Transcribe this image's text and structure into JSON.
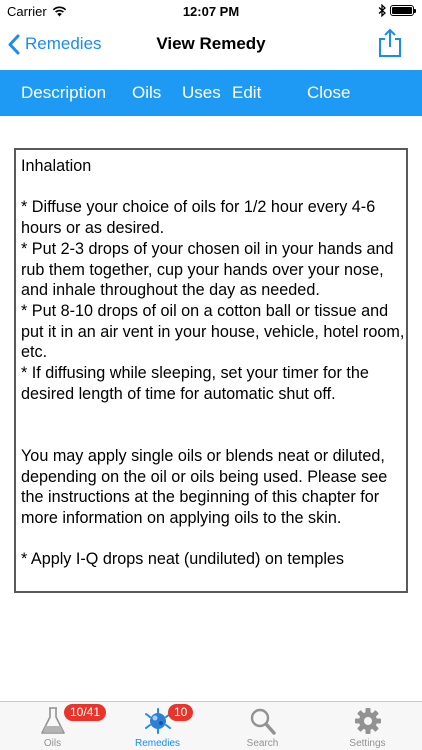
{
  "status_bar": {
    "carrier": "Carrier",
    "time": "12:07 PM",
    "signal_icon": "wifi-icon",
    "battery_icon": "battery-icon",
    "battery_level": 1.0
  },
  "nav": {
    "back_label": "Remedies",
    "title": "View Remedy",
    "share_icon": "share-icon"
  },
  "tabs": {
    "description": "Description",
    "oils": "Oils",
    "uses": "Uses",
    "edit": "Edit",
    "close": "Close"
  },
  "content": {
    "text": "Inhalation\n\n* Diffuse your choice of oils for 1/2 hour every 4-6 hours or as desired.\n* Put 2-3 drops of your chosen oil in your hands and rub them together, cup your hands over your nose, and inhale throughout the day as needed.\n* Put 8-10 drops of oil on a cotton ball or tissue and put it in an air vent in your house, vehicle, hotel room, etc.\n* If diffusing while sleeping, set your timer for the desired length of time for automatic shut off.\n\n\nYou may apply single oils or blends neat or diluted, depending on the oil or oils being used. Please see the instructions at the beginning of this chapter for more information on applying oils to the skin.\n\n* Apply I-Q drops neat (undiluted) on temples"
  },
  "tab_bar": {
    "items": [
      {
        "label": "Oils",
        "badge": "10/41",
        "icon": "flask-icon"
      },
      {
        "label": "Remedies",
        "badge": "10",
        "icon": "remedies-icon"
      },
      {
        "label": "Search",
        "badge": "",
        "icon": "search-icon"
      },
      {
        "label": "Settings",
        "badge": "",
        "icon": "gear-icon"
      }
    ]
  },
  "colors": {
    "accent": "#1a8cf0",
    "tab_strip": "#1e9af5",
    "badge": "#e8342a",
    "inactive_tab": "#929292"
  }
}
